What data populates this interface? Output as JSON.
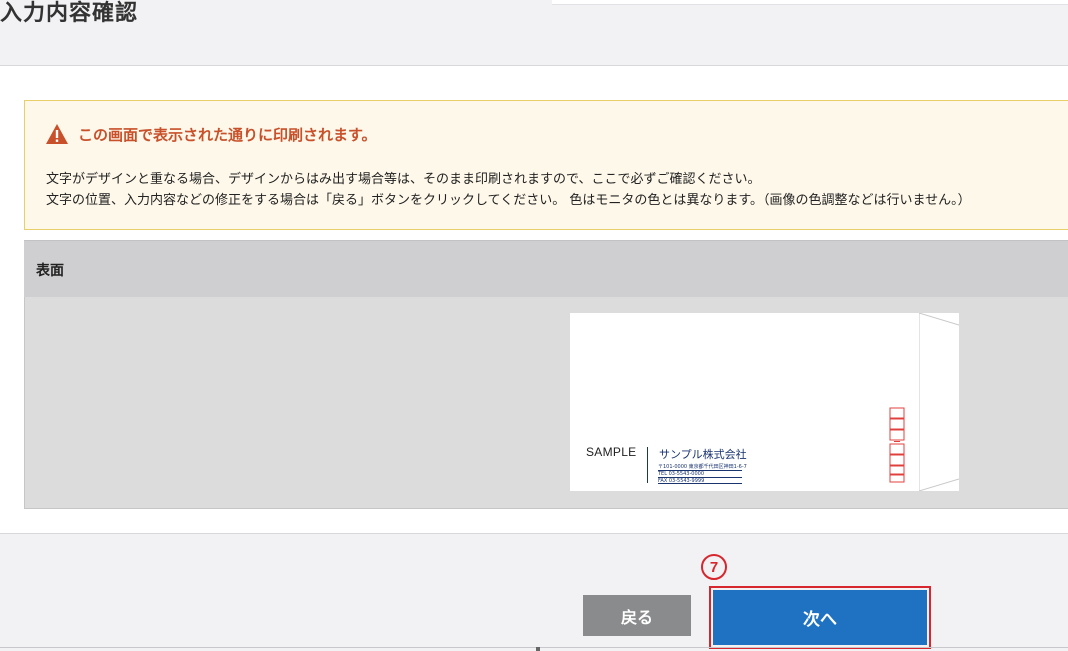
{
  "page": {
    "title": "入力内容確認"
  },
  "notice": {
    "title": "この画面で表示された通りに印刷されます。",
    "line1": "文字がデザインと重なる場合、デザインからはみ出す場合等は、そのまま印刷されますので、ここで必ずご確認ください。",
    "line2": "文字の位置、入力内容などの修正をする場合は「戻る」ボタンをクリックしてください。 色はモニタの色とは異なります。（画像の色調整などは行いません。）",
    "icon": "warning-icon",
    "accent_color": "#c8502a"
  },
  "preview": {
    "section_label": "表面",
    "envelope": {
      "sample_text": "SAMPLE",
      "company": "サンプル株式会社",
      "address": "〒101-0000 東京都千代田区神田1-6-7",
      "tel": "TEL 03-5543-0000",
      "fax": "FAX 03-5543-9999"
    }
  },
  "footer": {
    "back_label": "戻る",
    "next_label": "次へ",
    "step_marker": "7",
    "highlight_color": "#d7262d",
    "next_color": "#1f72c2"
  }
}
